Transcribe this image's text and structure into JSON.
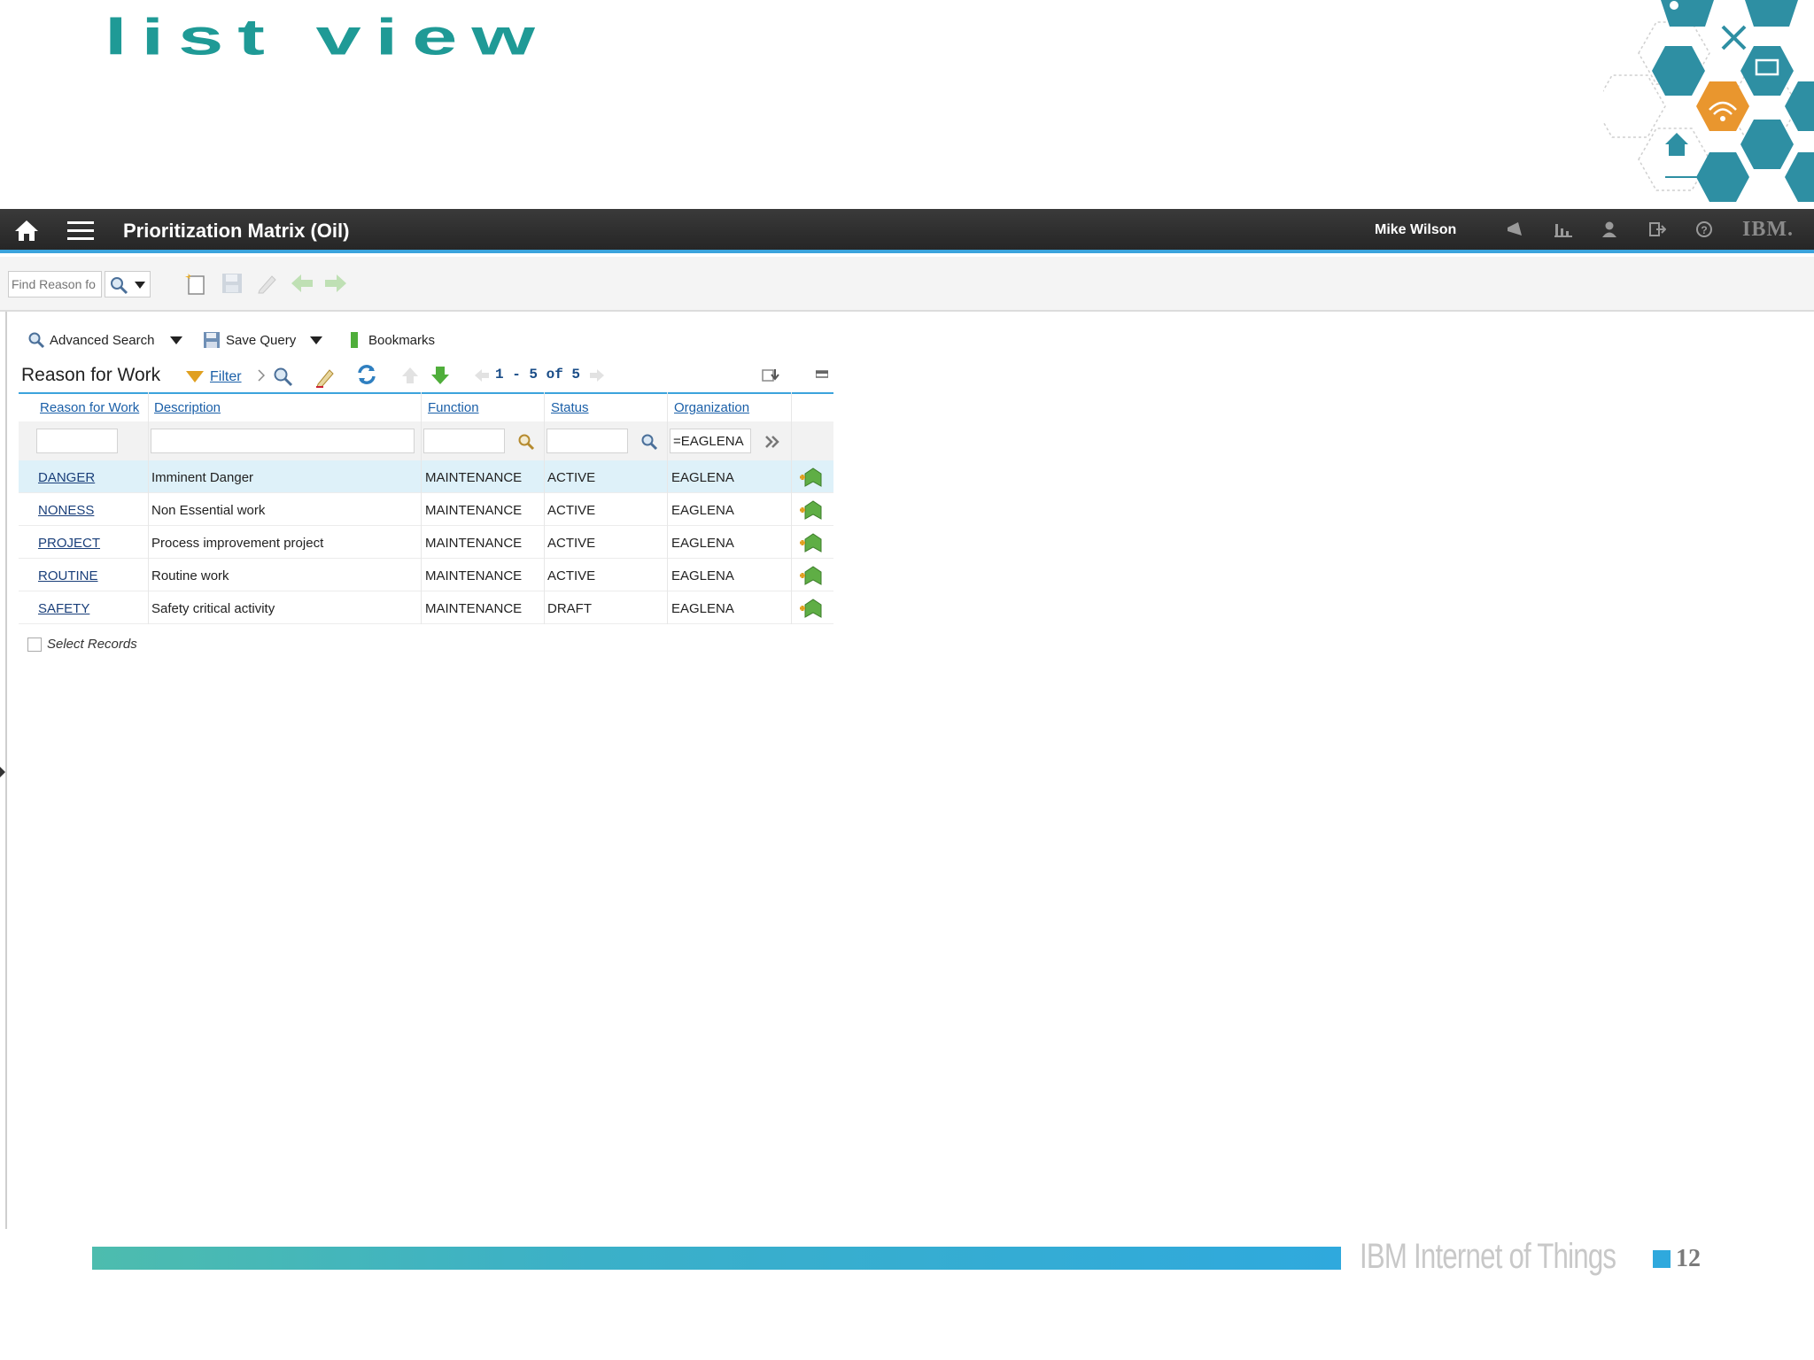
{
  "slide": {
    "title": "LIST VIEW",
    "footer_brand": "IBM Internet of Things",
    "page_number": "12"
  },
  "topbar": {
    "app_title": "Prioritization Matrix (Oil)",
    "user": "Mike Wilson",
    "brand": "IBM."
  },
  "toolbar": {
    "find_placeholder": "Find Reason fo"
  },
  "query_bar": {
    "advanced_search": "Advanced Search",
    "save_query": "Save Query",
    "bookmarks": "Bookmarks"
  },
  "list": {
    "title": "Reason for Work",
    "filter_label": "Filter",
    "pager": "1 - 5 of 5",
    "columns": [
      "Reason for Work",
      "Description",
      "Function",
      "Status",
      "Organization"
    ],
    "filters": {
      "organization": "=EAGLENA"
    },
    "rows": [
      {
        "key": "DANGER",
        "description": "Imminent Danger",
        "function": "MAINTENANCE",
        "status": "ACTIVE",
        "organization": "EAGLENA"
      },
      {
        "key": "NONESS",
        "description": "Non Essential work",
        "function": "MAINTENANCE",
        "status": "ACTIVE",
        "organization": "EAGLENA"
      },
      {
        "key": "PROJECT",
        "description": "Process improvement project",
        "function": "MAINTENANCE",
        "status": "ACTIVE",
        "organization": "EAGLENA"
      },
      {
        "key": "ROUTINE",
        "description": "Routine work",
        "function": "MAINTENANCE",
        "status": "ACTIVE",
        "organization": "EAGLENA"
      },
      {
        "key": "SAFETY",
        "description": "Safety critical activity",
        "function": "MAINTENANCE",
        "status": "DRAFT",
        "organization": "EAGLENA"
      }
    ],
    "select_records": "Select Records"
  },
  "colors": {
    "title_teal": "#1f9a96",
    "accent_blue": "#3ba3dc",
    "link_blue": "#1a5fa8",
    "selected_row": "#def1f9"
  },
  "icons": [
    "home-icon",
    "hamburger-menu-icon",
    "broadcast-icon",
    "chart-icon",
    "user-icon",
    "logout-icon",
    "help-icon",
    "search-icon",
    "new-record-icon",
    "save-icon",
    "edit-icon",
    "back-arrow-icon",
    "forward-arrow-icon",
    "bookmark-icon",
    "filter-icon",
    "refresh-icon",
    "download-icon",
    "bookmark-add-icon"
  ]
}
